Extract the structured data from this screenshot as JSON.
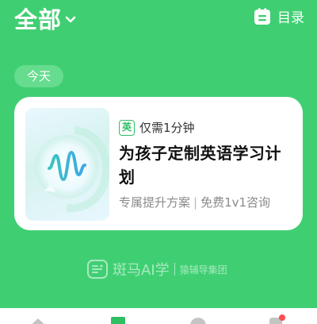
{
  "header": {
    "title": "全部",
    "catalog_label": "目录"
  },
  "section": {
    "date_label": "今天"
  },
  "card": {
    "badge": "英",
    "tag": "仅需1分钟",
    "title": "为孩子定制英语学习计划",
    "subtitle_left": "专属提升方案",
    "subtitle_sep": "|",
    "subtitle_right": "免费1v1咨询"
  },
  "brand": {
    "name": "斑马AI学",
    "sub": "猿辅导集团"
  },
  "tabbar": {
    "items": [
      {
        "icon": "home-icon"
      },
      {
        "icon": "bookmark-icon"
      },
      {
        "icon": "explore-icon"
      },
      {
        "icon": "profile-icon"
      }
    ]
  },
  "colors": {
    "background": "#3fcf72",
    "accent": "#2fbf63",
    "notification": "#ff4d4f"
  }
}
